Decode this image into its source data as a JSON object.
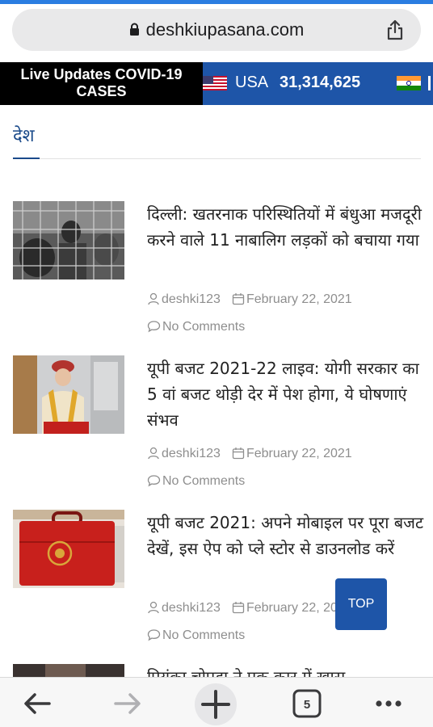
{
  "browser": {
    "url": "deshkiupasana.com",
    "tab_count": "5"
  },
  "ticker": {
    "label": "Live Updates COVID-19 CASES",
    "country": "USA",
    "count": "31,314,625"
  },
  "section": {
    "title": "देश"
  },
  "articles": [
    {
      "title": "दिल्ली: खतरनाक परिस्थितियों में बंधुआ मजदूरी करने वाले 11 नाबालिग लड़कों को बचाया गया",
      "author": "deshki123",
      "date": "February 22, 2021",
      "comments": "No Comments"
    },
    {
      "title": "यूपी बजट 2021-22 लाइव: योगी सरकार का 5 वां बजट थोड़ी देर में पेश होगा, ये घोषणाएं संभव",
      "author": "deshki123",
      "date": "February 22, 2021",
      "comments": "No Comments"
    },
    {
      "title": "यूपी बजट 2021: अपने मोबाइल पर पूरा बजट देखें, इस ऐप को प्ले स्टोर से डाउनलोड करें",
      "author": "deshki123",
      "date": "February 22, 2021",
      "comments": "No Comments"
    },
    {
      "title": "प्रियंका चोपड़ा ने एक कार में ख़ास"
    }
  ],
  "top_button": "TOP",
  "colors": {
    "brand_blue": "#1e55a8",
    "meta_gray": "#8e8e8e"
  }
}
